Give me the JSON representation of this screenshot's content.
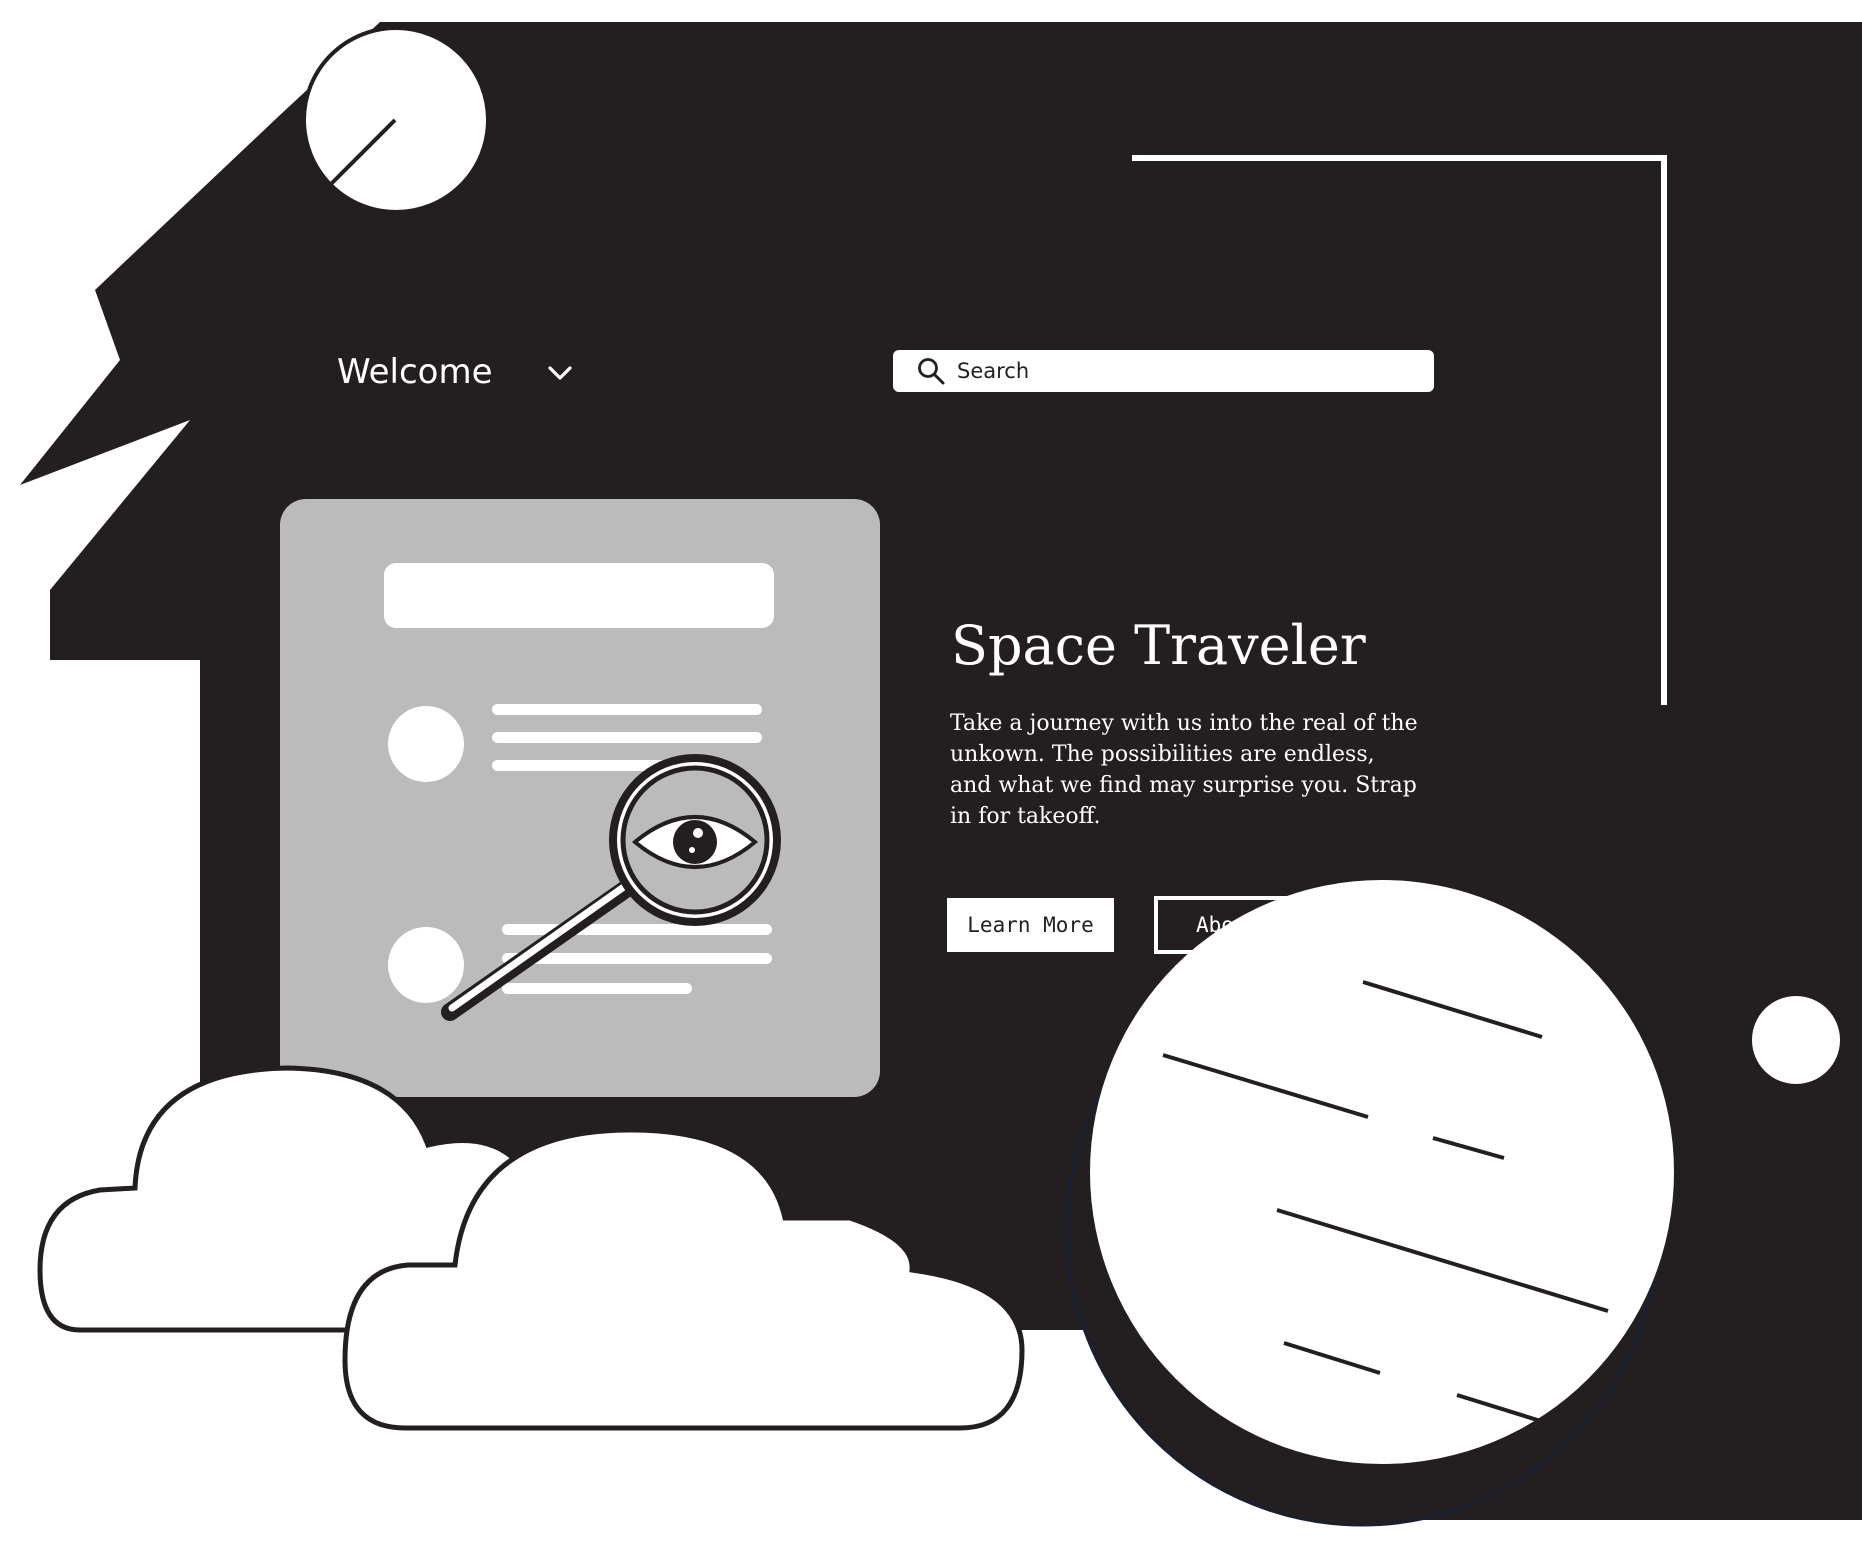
{
  "header": {
    "title": "Welcome",
    "dropdown_icon": "chevron-down-icon"
  },
  "search": {
    "placeholder": "Search",
    "icon": "search-icon"
  },
  "hero": {
    "title": "Space Traveler",
    "body": "Take a journey with us into the real of the unkown. The possibilities are endless, and what we find may surprise you. Strap in for takeoff."
  },
  "buttons": {
    "learn_more": "Learn More",
    "about": "About"
  },
  "colors": {
    "window": "#231f20",
    "card": "#bcbbbc",
    "white": "#ffffff"
  }
}
